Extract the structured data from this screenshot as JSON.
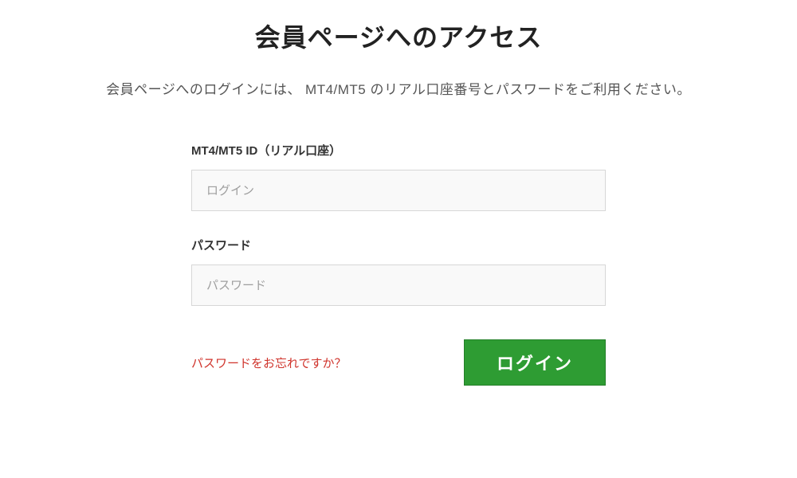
{
  "header": {
    "title": "会員ページへのアクセス",
    "subtitle": "会員ページへのログインには、 MT4/MT5 のリアル口座番号とパスワードをご利用ください。"
  },
  "form": {
    "id_label": "MT4/MT5 ID（リアル口座）",
    "id_placeholder": "ログイン",
    "password_label": "パスワード",
    "password_placeholder": "パスワード",
    "forgot_link": "パスワードをお忘れですか？",
    "login_button": "ログイン"
  }
}
